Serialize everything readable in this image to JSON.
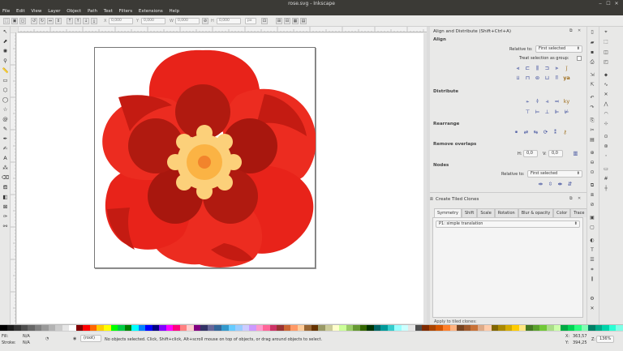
{
  "window": {
    "title": "rose.svg - Inkscape",
    "controls": [
      "‒",
      "☐",
      "✕"
    ]
  },
  "menu": [
    "File",
    "Edit",
    "View",
    "Layer",
    "Object",
    "Path",
    "Text",
    "Filters",
    "Extensions",
    "Help"
  ],
  "toolbar": {
    "x_label": "X",
    "x_value": "0,000",
    "y_label": "Y",
    "y_value": "0,000",
    "w_label": "W",
    "w_value": "0,000",
    "h_label": "H",
    "h_value": "0,000",
    "unit": "px"
  },
  "align_panel": {
    "title": "Align and Distribute (Shift+Ctrl+A)",
    "align_heading": "Align",
    "relative_to_label": "Relative to:",
    "relative_to_value": "First selected",
    "treat_selection_label": "Treat selection as group:",
    "distribute_heading": "Distribute",
    "rearrange_heading": "Rearrange",
    "remove_overlaps_heading": "Remove overlaps",
    "h_label": "H:",
    "h_value": "0,0",
    "v_label": "V:",
    "v_value": "0,0",
    "nodes_heading": "Nodes",
    "nodes_relative_label": "Relative to:",
    "nodes_relative_value": "First selected"
  },
  "clones_panel": {
    "title": "Create Tiled Clones",
    "tabs": [
      "Symmetry",
      "Shift",
      "Scale",
      "Rotation",
      "Blur & opacity",
      "Color",
      "Trace"
    ],
    "symmetry_value": "P1: simple translation",
    "apply_label": "Apply to tiled clones:"
  },
  "status": {
    "fill_label": "Fill:",
    "fill_value": "N/A",
    "stroke_label": "Stroke:",
    "stroke_value": "N/A",
    "layer_value": "(root)",
    "message": "No objects selected. Click, Shift+click, Alt+scroll mouse on top of objects, or drag around objects to select.",
    "x_label": "X:",
    "x_value": "363,57",
    "y_label": "Y:",
    "y_value": "394,25",
    "z_label": "Z:",
    "zoom_value": "136%"
  },
  "colors": {
    "petal_outer": "#e8231a",
    "petal_light": "#f2392d",
    "petal_dark": "#b01a10",
    "petal_inner": "#a8170e",
    "center_ring": "#fcd07a",
    "center_mid": "#fbb344",
    "center_core": "#f2842c"
  },
  "palette": [
    "#000000",
    "#1a1a1a",
    "#333333",
    "#4d4d4d",
    "#666666",
    "#808080",
    "#999999",
    "#b3b3b3",
    "#cccccc",
    "#e6e6e6",
    "#ffffff",
    "#800000",
    "#ff0000",
    "#ff6600",
    "#ffcc00",
    "#ffff00",
    "#00ff00",
    "#00cc44",
    "#008000",
    "#00ffff",
    "#0080ff",
    "#0000ff",
    "#000080",
    "#8000ff",
    "#ff00ff",
    "#ff0080",
    "#ff8080",
    "#ffcccc",
    "#800080",
    "#333366",
    "#666699",
    "#336699",
    "#3399cc",
    "#66ccff",
    "#99ccff",
    "#ccccff",
    "#cc99ff",
    "#ff99cc",
    "#ff6699",
    "#cc3366",
    "#993333",
    "#cc6633",
    "#ff9966",
    "#ffcc99",
    "#996633",
    "#663300",
    "#999966",
    "#cccc99",
    "#ffffcc",
    "#ccff99",
    "#99cc66",
    "#669933",
    "#336600",
    "#003300",
    "#006666",
    "#009999",
    "#33cccc",
    "#99ffff",
    "#ccffff",
    "#e6e6e6",
    "#4d4d4d",
    "#7f2a00",
    "#aa4400",
    "#d45500",
    "#ff7f2a",
    "#ffb380",
    "#784421",
    "#a05a2c",
    "#c87137",
    "#deaa87",
    "#ffccaa",
    "#806600",
    "#aa8800",
    "#d4aa00",
    "#ffcc00",
    "#ffe680",
    "#447821",
    "#5aa02c",
    "#71c837",
    "#aade87",
    "#ccffaa",
    "#00aa44",
    "#00d455",
    "#2aff80",
    "#80ffb3",
    "#008066",
    "#00aa88",
    "#00d4aa",
    "#2affd5",
    "#80ffe6"
  ]
}
